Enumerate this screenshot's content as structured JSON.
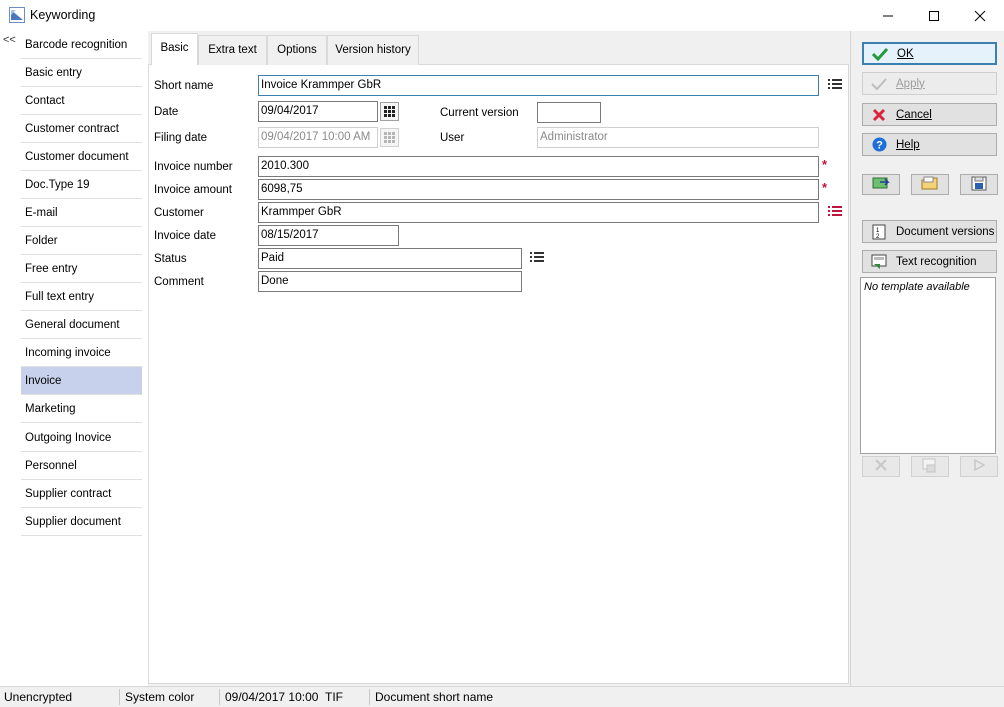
{
  "window": {
    "title": "Keywording",
    "min_icon": "minimize-icon",
    "max_icon": "maximize-icon",
    "close_icon": "close-icon"
  },
  "left_panel": {
    "collapse_label": "<<",
    "items": [
      {
        "label": "Barcode recognition"
      },
      {
        "label": "Basic entry"
      },
      {
        "label": "Contact"
      },
      {
        "label": "Customer contract"
      },
      {
        "label": "Customer document"
      },
      {
        "label": "Doc.Type 19"
      },
      {
        "label": "E-mail"
      },
      {
        "label": "Folder"
      },
      {
        "label": "Free entry"
      },
      {
        "label": "Full text entry"
      },
      {
        "label": "General document"
      },
      {
        "label": "Incoming invoice"
      },
      {
        "label": "Invoice"
      },
      {
        "label": "Marketing"
      },
      {
        "label": "Outgoing Inovice"
      },
      {
        "label": "Personnel"
      },
      {
        "label": "Supplier contract"
      },
      {
        "label": "Supplier document"
      }
    ],
    "selected": "Invoice"
  },
  "tabs": [
    {
      "label": "Basic"
    },
    {
      "label": "Extra text"
    },
    {
      "label": "Options"
    },
    {
      "label": "Version history"
    }
  ],
  "form": {
    "short_name": {
      "label": "Short name",
      "value": "Invoice Krammper GbR"
    },
    "date": {
      "label": "Date",
      "value": "09/04/2017"
    },
    "current_version": {
      "label": "Current version",
      "value": ""
    },
    "filing_date": {
      "label": "Filing date",
      "value": "09/04/2017 10:00 AM"
    },
    "user": {
      "label": "User",
      "value": "Administrator"
    },
    "invoice_number": {
      "label": "Invoice number",
      "value": "2010.300"
    },
    "invoice_amount": {
      "label": "Invoice amount",
      "value": "6098,75"
    },
    "customer": {
      "label": "Customer",
      "value": "Krammper  GbR"
    },
    "invoice_date": {
      "label": "Invoice date",
      "value": "08/15/2017"
    },
    "status": {
      "label": "Status",
      "value": "Paid"
    },
    "comment": {
      "label": "Comment",
      "value": "Done"
    },
    "required_marker": "*"
  },
  "right_panel": {
    "ok": {
      "label": "OK",
      "icon": "checkmark-icon"
    },
    "apply": {
      "label": "Apply",
      "icon": "checkmark-icon"
    },
    "cancel": {
      "label": "Cancel",
      "icon": "x-icon"
    },
    "help": {
      "label": "Help",
      "icon": "help-icon"
    },
    "document_versions": {
      "label": "Document versions",
      "icon": "versions-icon"
    },
    "text_recognition": {
      "label": "Text recognition",
      "icon": "ocr-icon"
    },
    "template_text": "No template available"
  },
  "status_bar": {
    "encryption": "Unencrypted",
    "color": "System color",
    "date": "09/04/2017 10:00 AM",
    "file_type": "TIF",
    "short_name_label": "Document short name"
  },
  "colors": {
    "accent": "#3c7fb1",
    "selection": "#c7d1ec",
    "required": "#c0143c",
    "cancel_red": "#d7263d",
    "help_blue": "#1e6fd9",
    "ok_green": "#239b3c"
  }
}
